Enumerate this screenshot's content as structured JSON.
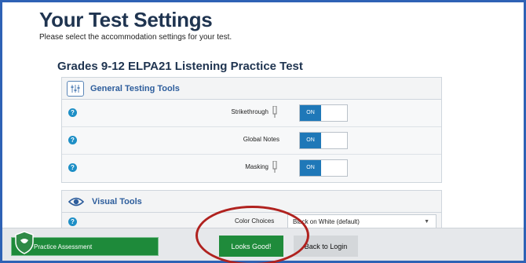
{
  "header": {
    "title": "Your Test Settings",
    "subtitle": "Please select the accommodation settings for your test."
  },
  "test_name": "Grades 9-12 ELPA21 Listening Practice Test",
  "sections": {
    "general": {
      "title": "General Testing Tools",
      "rows": [
        {
          "label": "Strikethrough",
          "toggle": "ON"
        },
        {
          "label": "Global Notes",
          "toggle": "ON"
        },
        {
          "label": "Masking",
          "toggle": "ON"
        }
      ]
    },
    "visual": {
      "title": "Visual Tools",
      "color_label": "Color Choices",
      "color_value": "Black on White (default)"
    }
  },
  "footer": {
    "practice_label": "Practice Assessment",
    "looks_good_label": "Looks Good!",
    "back_label": "Back to Login"
  },
  "colors": {
    "frame": "#2e62b5",
    "title": "#1f3450",
    "section_title": "#2d5d9c",
    "toggle_on": "#1f78b8",
    "green_button": "#1f8b3b",
    "highlight": "#b0221f"
  }
}
